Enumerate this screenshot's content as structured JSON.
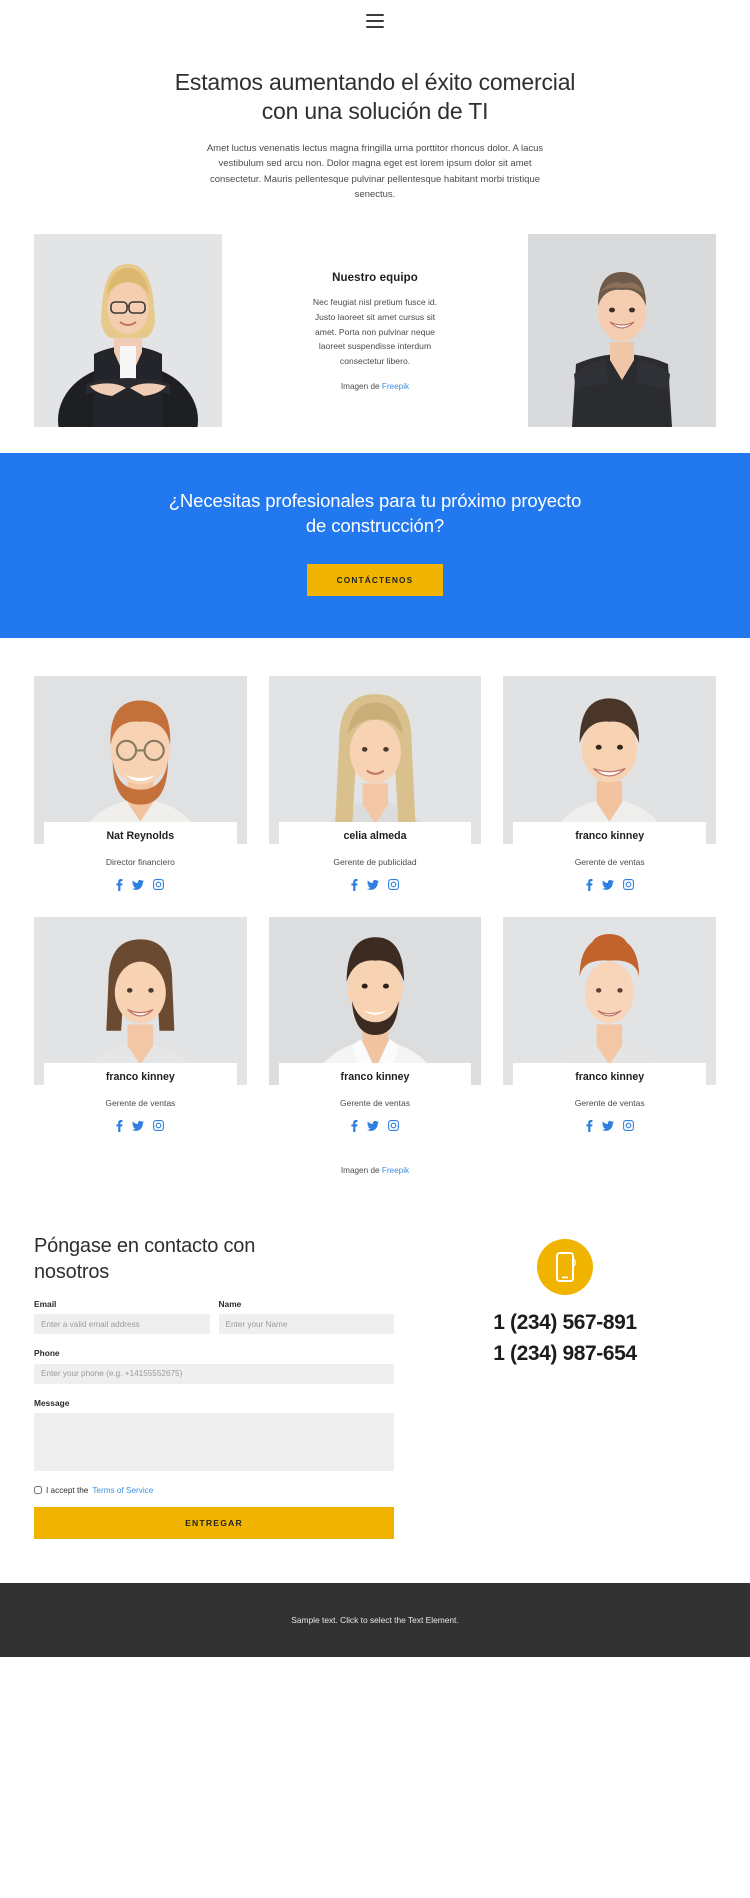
{
  "header": {
    "menu_icon": "hamburger-icon"
  },
  "hero": {
    "title": "Estamos aumentando el éxito comercial con una solución de TI",
    "paragraph": "Amet luctus venenatis lectus magna fringilla urna porttitor rhoncus dolor. A lacus vestibulum sed arcu non. Dolor magna eget est lorem ipsum dolor sit amet consectetur. Mauris pellentesque pulvinar pellentesque habitant morbi tristique senectus."
  },
  "team_intro": {
    "heading": "Nuestro equipo",
    "paragraph": "Nec feugiat nisl pretium fusce id. Justo laoreet sit amet cursus sit amet. Porta non pulvinar neque laoreet suspendisse interdum consectetur libero.",
    "credit_prefix": "Imagen de ",
    "credit_link": "Freepik",
    "left_photo_alt": "businesswoman-portrait",
    "right_photo_alt": "young-man-portrait"
  },
  "cta": {
    "title": "¿Necesitas profesionales para tu próximo proyecto de construcción?",
    "button_label": "CONTÁCTENOS",
    "background_color": "#2278ef",
    "button_color": "#f0b400"
  },
  "team_grid": {
    "members": [
      {
        "name": "Nat Reynolds",
        "role": "Director financiero"
      },
      {
        "name": "celia almeda",
        "role": "Gerente de publicidad"
      },
      {
        "name": "franco kinney",
        "role": "Gerente de ventas"
      },
      {
        "name": "franco kinney",
        "role": "Gerente de ventas"
      },
      {
        "name": "franco kinney",
        "role": "Gerente de ventas"
      },
      {
        "name": "franco kinney",
        "role": "Gerente de ventas"
      }
    ],
    "social_icons": [
      "facebook-icon",
      "twitter-icon",
      "instagram-icon"
    ],
    "social_color": "#2e7fe0",
    "credit_prefix": "Imagen de ",
    "credit_link": "Freepik"
  },
  "contact": {
    "heading": "Póngase en contacto con nosotros",
    "fields": {
      "email_label": "Email",
      "email_placeholder": "Enter a valid email address",
      "name_label": "Name",
      "name_placeholder": "Enter your Name",
      "phone_label": "Phone",
      "phone_placeholder": "Enter your phone (e.g. +14155552675)",
      "message_label": "Message",
      "message_placeholder": ""
    },
    "terms_prefix": "I accept the ",
    "terms_link": "Terms of Service",
    "submit_label": "ENTREGAR",
    "phone_icon": "mobile-phone-icon",
    "phone_numbers": [
      "1 (234) 567-891",
      "1 (234) 987-654"
    ]
  },
  "footer": {
    "text": "Sample text. Click to select the Text Element."
  }
}
